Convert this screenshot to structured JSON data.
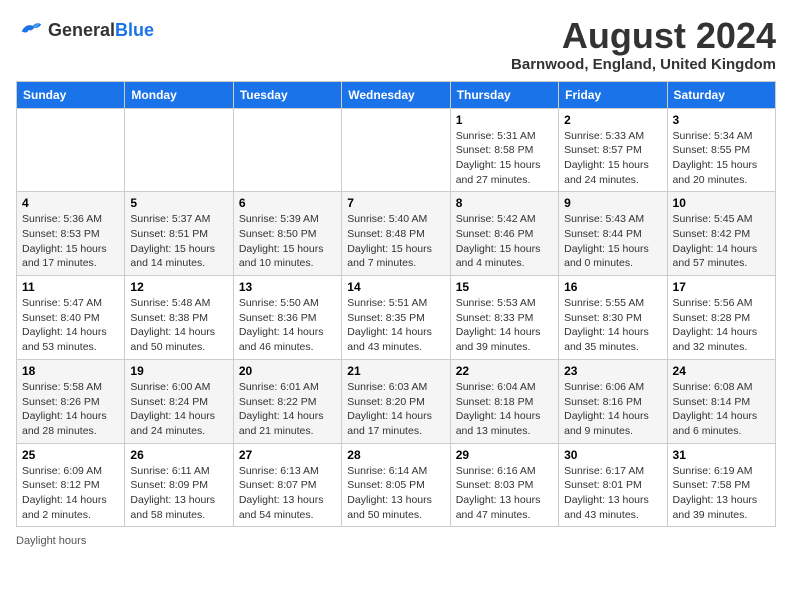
{
  "header": {
    "logo_general": "General",
    "logo_blue": "Blue",
    "month_title": "August 2024",
    "location": "Barnwood, England, United Kingdom"
  },
  "weekdays": [
    "Sunday",
    "Monday",
    "Tuesday",
    "Wednesday",
    "Thursday",
    "Friday",
    "Saturday"
  ],
  "weeks": [
    [
      {
        "day": "",
        "info": ""
      },
      {
        "day": "",
        "info": ""
      },
      {
        "day": "",
        "info": ""
      },
      {
        "day": "",
        "info": ""
      },
      {
        "day": "1",
        "info": "Sunrise: 5:31 AM\nSunset: 8:58 PM\nDaylight: 15 hours and 27 minutes."
      },
      {
        "day": "2",
        "info": "Sunrise: 5:33 AM\nSunset: 8:57 PM\nDaylight: 15 hours and 24 minutes."
      },
      {
        "day": "3",
        "info": "Sunrise: 5:34 AM\nSunset: 8:55 PM\nDaylight: 15 hours and 20 minutes."
      }
    ],
    [
      {
        "day": "4",
        "info": "Sunrise: 5:36 AM\nSunset: 8:53 PM\nDaylight: 15 hours and 17 minutes."
      },
      {
        "day": "5",
        "info": "Sunrise: 5:37 AM\nSunset: 8:51 PM\nDaylight: 15 hours and 14 minutes."
      },
      {
        "day": "6",
        "info": "Sunrise: 5:39 AM\nSunset: 8:50 PM\nDaylight: 15 hours and 10 minutes."
      },
      {
        "day": "7",
        "info": "Sunrise: 5:40 AM\nSunset: 8:48 PM\nDaylight: 15 hours and 7 minutes."
      },
      {
        "day": "8",
        "info": "Sunrise: 5:42 AM\nSunset: 8:46 PM\nDaylight: 15 hours and 4 minutes."
      },
      {
        "day": "9",
        "info": "Sunrise: 5:43 AM\nSunset: 8:44 PM\nDaylight: 15 hours and 0 minutes."
      },
      {
        "day": "10",
        "info": "Sunrise: 5:45 AM\nSunset: 8:42 PM\nDaylight: 14 hours and 57 minutes."
      }
    ],
    [
      {
        "day": "11",
        "info": "Sunrise: 5:47 AM\nSunset: 8:40 PM\nDaylight: 14 hours and 53 minutes."
      },
      {
        "day": "12",
        "info": "Sunrise: 5:48 AM\nSunset: 8:38 PM\nDaylight: 14 hours and 50 minutes."
      },
      {
        "day": "13",
        "info": "Sunrise: 5:50 AM\nSunset: 8:36 PM\nDaylight: 14 hours and 46 minutes."
      },
      {
        "day": "14",
        "info": "Sunrise: 5:51 AM\nSunset: 8:35 PM\nDaylight: 14 hours and 43 minutes."
      },
      {
        "day": "15",
        "info": "Sunrise: 5:53 AM\nSunset: 8:33 PM\nDaylight: 14 hours and 39 minutes."
      },
      {
        "day": "16",
        "info": "Sunrise: 5:55 AM\nSunset: 8:30 PM\nDaylight: 14 hours and 35 minutes."
      },
      {
        "day": "17",
        "info": "Sunrise: 5:56 AM\nSunset: 8:28 PM\nDaylight: 14 hours and 32 minutes."
      }
    ],
    [
      {
        "day": "18",
        "info": "Sunrise: 5:58 AM\nSunset: 8:26 PM\nDaylight: 14 hours and 28 minutes."
      },
      {
        "day": "19",
        "info": "Sunrise: 6:00 AM\nSunset: 8:24 PM\nDaylight: 14 hours and 24 minutes."
      },
      {
        "day": "20",
        "info": "Sunrise: 6:01 AM\nSunset: 8:22 PM\nDaylight: 14 hours and 21 minutes."
      },
      {
        "day": "21",
        "info": "Sunrise: 6:03 AM\nSunset: 8:20 PM\nDaylight: 14 hours and 17 minutes."
      },
      {
        "day": "22",
        "info": "Sunrise: 6:04 AM\nSunset: 8:18 PM\nDaylight: 14 hours and 13 minutes."
      },
      {
        "day": "23",
        "info": "Sunrise: 6:06 AM\nSunset: 8:16 PM\nDaylight: 14 hours and 9 minutes."
      },
      {
        "day": "24",
        "info": "Sunrise: 6:08 AM\nSunset: 8:14 PM\nDaylight: 14 hours and 6 minutes."
      }
    ],
    [
      {
        "day": "25",
        "info": "Sunrise: 6:09 AM\nSunset: 8:12 PM\nDaylight: 14 hours and 2 minutes."
      },
      {
        "day": "26",
        "info": "Sunrise: 6:11 AM\nSunset: 8:09 PM\nDaylight: 13 hours and 58 minutes."
      },
      {
        "day": "27",
        "info": "Sunrise: 6:13 AM\nSunset: 8:07 PM\nDaylight: 13 hours and 54 minutes."
      },
      {
        "day": "28",
        "info": "Sunrise: 6:14 AM\nSunset: 8:05 PM\nDaylight: 13 hours and 50 minutes."
      },
      {
        "day": "29",
        "info": "Sunrise: 6:16 AM\nSunset: 8:03 PM\nDaylight: 13 hours and 47 minutes."
      },
      {
        "day": "30",
        "info": "Sunrise: 6:17 AM\nSunset: 8:01 PM\nDaylight: 13 hours and 43 minutes."
      },
      {
        "day": "31",
        "info": "Sunrise: 6:19 AM\nSunset: 7:58 PM\nDaylight: 13 hours and 39 minutes."
      }
    ]
  ],
  "footer": {
    "note": "Daylight hours"
  }
}
